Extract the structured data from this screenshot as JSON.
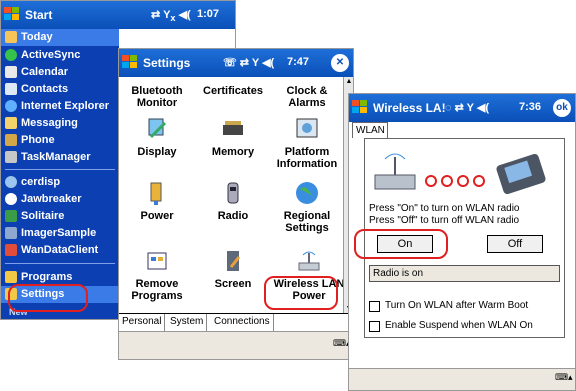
{
  "start": {
    "title": "Start",
    "time": "1:07",
    "items": [
      {
        "label": "Today",
        "selected": true
      },
      {
        "label": "ActiveSync"
      },
      {
        "label": "Calendar"
      },
      {
        "label": "Contacts"
      },
      {
        "label": "Internet Explorer"
      },
      {
        "label": "Messaging"
      },
      {
        "label": "Phone"
      },
      {
        "label": "TaskManager"
      },
      {
        "label": "cerdisp"
      },
      {
        "label": "Jawbreaker"
      },
      {
        "label": "Solitaire"
      },
      {
        "label": "ImagerSample"
      },
      {
        "label": "WanDataClient"
      },
      {
        "label": "Programs"
      },
      {
        "label": "Settings"
      }
    ],
    "footer_label": "New"
  },
  "settings": {
    "title": "Settings",
    "time": "7:47",
    "cells": [
      {
        "label": "Bluetooth Monitor",
        "icon": "bluetooth-icon"
      },
      {
        "label": "Certificates",
        "icon": "certificates-icon"
      },
      {
        "label": "Clock & Alarms",
        "icon": "clock-icon"
      },
      {
        "label": "Display",
        "icon": "display-icon"
      },
      {
        "label": "Memory",
        "icon": "memory-icon"
      },
      {
        "label": "Platform Information",
        "icon": "platform-icon"
      },
      {
        "label": "Power",
        "icon": "power-icon"
      },
      {
        "label": "Radio",
        "icon": "radio-icon"
      },
      {
        "label": "Regional Settings",
        "icon": "globe-icon"
      },
      {
        "label": "Remove Programs",
        "icon": "remove-programs-icon"
      },
      {
        "label": "Screen",
        "icon": "screen-icon"
      },
      {
        "label": "Wireless LAN Power",
        "icon": "wireless-icon"
      }
    ],
    "tabs": [
      "Personal",
      "System",
      "Connections"
    ],
    "active_tab": "System"
  },
  "wlan": {
    "title": "Wireless LA!",
    "time": "7:36",
    "ok_label": "ok",
    "tab_label": "WLAN",
    "instruction_on": "Press \"On\" to turn on WLAN radio",
    "instruction_off": "Press \"Off\" to turn off WLAN radio",
    "on_label": "On",
    "off_label": "Off",
    "status_text": "Radio is on",
    "option_warm_boot": "Turn On WLAN after Warm Boot",
    "option_suspend": "Enable Suspend when WLAN On",
    "warm_boot_checked": false,
    "suspend_checked": false
  },
  "colors": {
    "title_bar": "#0a4fb8",
    "start_menu": "#0c3fb1",
    "highlight": "#e02020"
  }
}
